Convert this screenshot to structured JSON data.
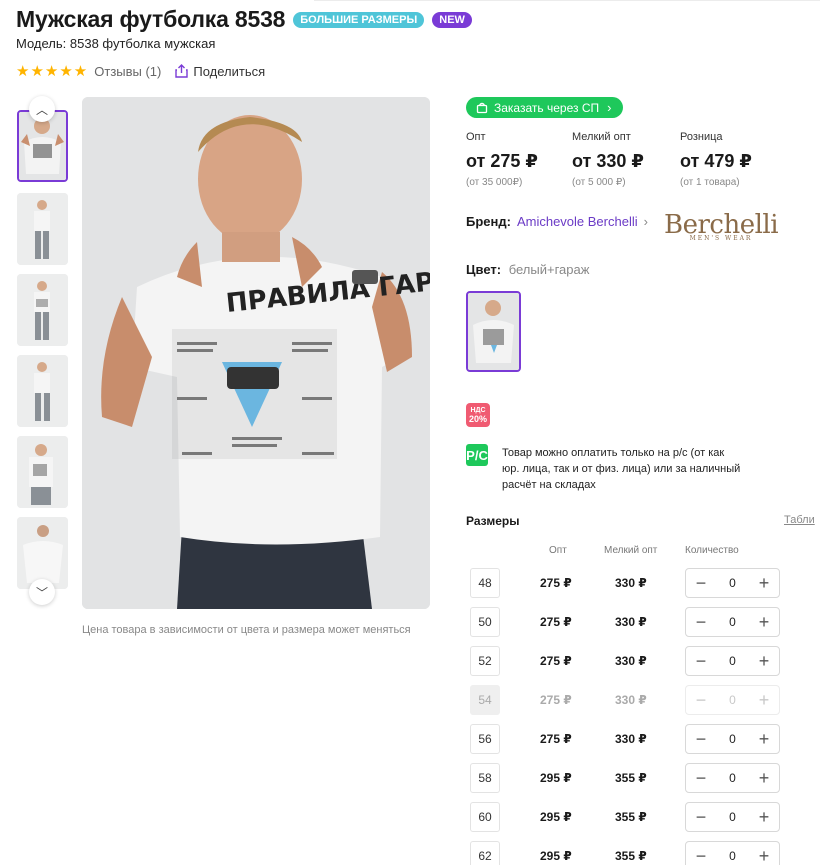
{
  "product": {
    "title": "Мужская футболка 8538",
    "badges": [
      "БОЛЬШИЕ РАЗМЕРЫ",
      "NEW"
    ],
    "model": "Модель: 8538 футболка мужская",
    "stars": "★★★★★",
    "rating_stars": 5,
    "reviews": "Отзывы (1)",
    "share": "Поделиться"
  },
  "gallery": {
    "note": "Цена товара в зависимости от цвета и размера может меняться",
    "shirt_text": "ПРАВИЛА ГАРАЖА"
  },
  "order_button": "Заказать через СП",
  "prices": [
    {
      "label": "Опт",
      "value": "от 275 ₽",
      "min": "(от 35 000₽)"
    },
    {
      "label": "Мелкий опт",
      "value": "от 330 ₽",
      "min": "(от 5 000 ₽)"
    },
    {
      "label": "Розница",
      "value": "от 479 ₽",
      "min": "(от 1 товара)"
    }
  ],
  "brand": {
    "label": "Бренд:",
    "name": "Amichevole Berchelli",
    "logo_text": "Berchelli",
    "logo_sub": "MEN'S WEAR"
  },
  "color": {
    "label": "Цвет:",
    "value": "белый+гараж"
  },
  "vat": {
    "line1": "НДС",
    "line2": "20%"
  },
  "payment": {
    "icon": "Р/С",
    "text": "Товар можно оплатить только на р/с (от как юр. лица, так и от физ. лица) или за наличный расчёт на складах"
  },
  "sizes": {
    "title": "Размеры",
    "table_link": "Табли",
    "headers": {
      "opt": "Опт",
      "small": "Мелкий опт",
      "qty": "Количество"
    },
    "rows": [
      {
        "size": "48",
        "opt": "275 ₽",
        "small": "330 ₽",
        "qty": "0",
        "disabled": false
      },
      {
        "size": "50",
        "opt": "275 ₽",
        "small": "330 ₽",
        "qty": "0",
        "disabled": false
      },
      {
        "size": "52",
        "opt": "275 ₽",
        "small": "330 ₽",
        "qty": "0",
        "disabled": false
      },
      {
        "size": "54",
        "opt": "275 ₽",
        "small": "330 ₽",
        "qty": "0",
        "disabled": true
      },
      {
        "size": "56",
        "opt": "275 ₽",
        "small": "330 ₽",
        "qty": "0",
        "disabled": false
      },
      {
        "size": "58",
        "opt": "295 ₽",
        "small": "355 ₽",
        "qty": "0",
        "disabled": false
      },
      {
        "size": "60",
        "opt": "295 ₽",
        "small": "355 ₽",
        "qty": "0",
        "disabled": false
      },
      {
        "size": "62",
        "opt": "295 ₽",
        "small": "355 ₽",
        "qty": "0",
        "disabled": false
      }
    ]
  },
  "colors": {
    "accent": "#7a3bd6",
    "green": "#1ec85b",
    "star": "#ffb400",
    "badge_cyan": "#4fc5d8",
    "vat": "#f05b72"
  }
}
